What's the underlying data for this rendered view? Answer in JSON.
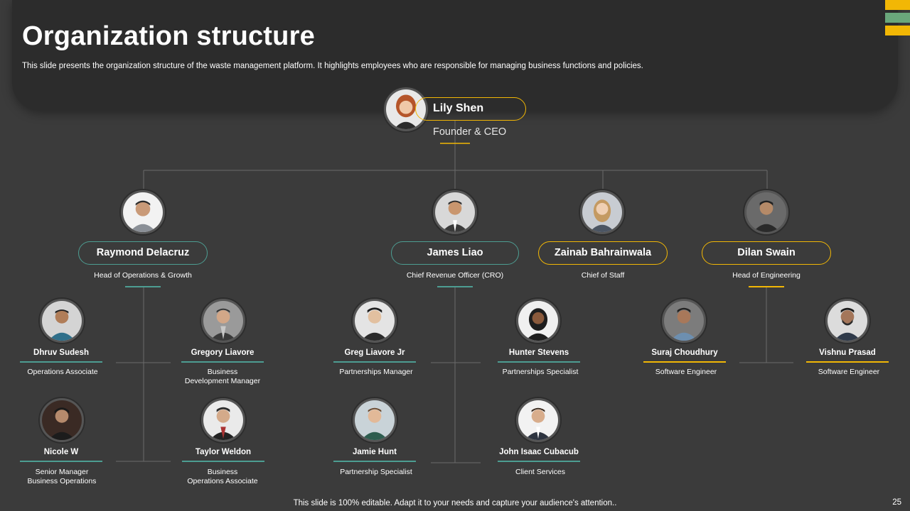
{
  "header": {
    "title": "Organization structure",
    "subtitle": "This slide presents the organization structure of the waste management platform. It highlights employees who are responsible for managing business functions and policies."
  },
  "colors": {
    "background": "#3b3b3b",
    "panel": "#2c2c2c",
    "gold": "#f2b705",
    "teal": "#4d9d92",
    "green_bar": "#6aa77b",
    "connector": "#6b6b6b"
  },
  "ceo": {
    "name": "Lily Shen",
    "title": "Founder & CEO"
  },
  "leaders": [
    {
      "name": "Raymond Delacruz",
      "title": "Head of Operations & Growth"
    },
    {
      "name": "James Liao",
      "title": "Chief Revenue Officer (CRO)"
    },
    {
      "name": "Zainab Bahrainwala",
      "title": "Chief of Staff"
    },
    {
      "name": "Dilan Swain",
      "title": "Head of Engineering"
    }
  ],
  "staff": [
    {
      "name": "Dhruv Sudesh",
      "title": "Operations Associate"
    },
    {
      "name": "Gregory Liavore",
      "title": "Business\nDevelopment Manager"
    },
    {
      "name": "Nicole W",
      "title": "Senior Manager\nBusiness Operations"
    },
    {
      "name": "Taylor Weldon",
      "title": "Business\nOperations Associate"
    },
    {
      "name": "Greg Liavore Jr",
      "title": "Partnerships Manager"
    },
    {
      "name": "Hunter Stevens",
      "title": "Partnerships Specialist"
    },
    {
      "name": "Jamie Hunt",
      "title": "Partnership Specialist"
    },
    {
      "name": "John Isaac Cubacub",
      "title": "Client Services"
    },
    {
      "name": "Suraj Choudhury",
      "title": "Software Engineer"
    },
    {
      "name": "Vishnu Prasad",
      "title": "Software Engineer"
    }
  ],
  "footer": {
    "note": "This slide is 100% editable. Adapt it to your needs and capture your audience's attention..",
    "page_number": "25"
  }
}
